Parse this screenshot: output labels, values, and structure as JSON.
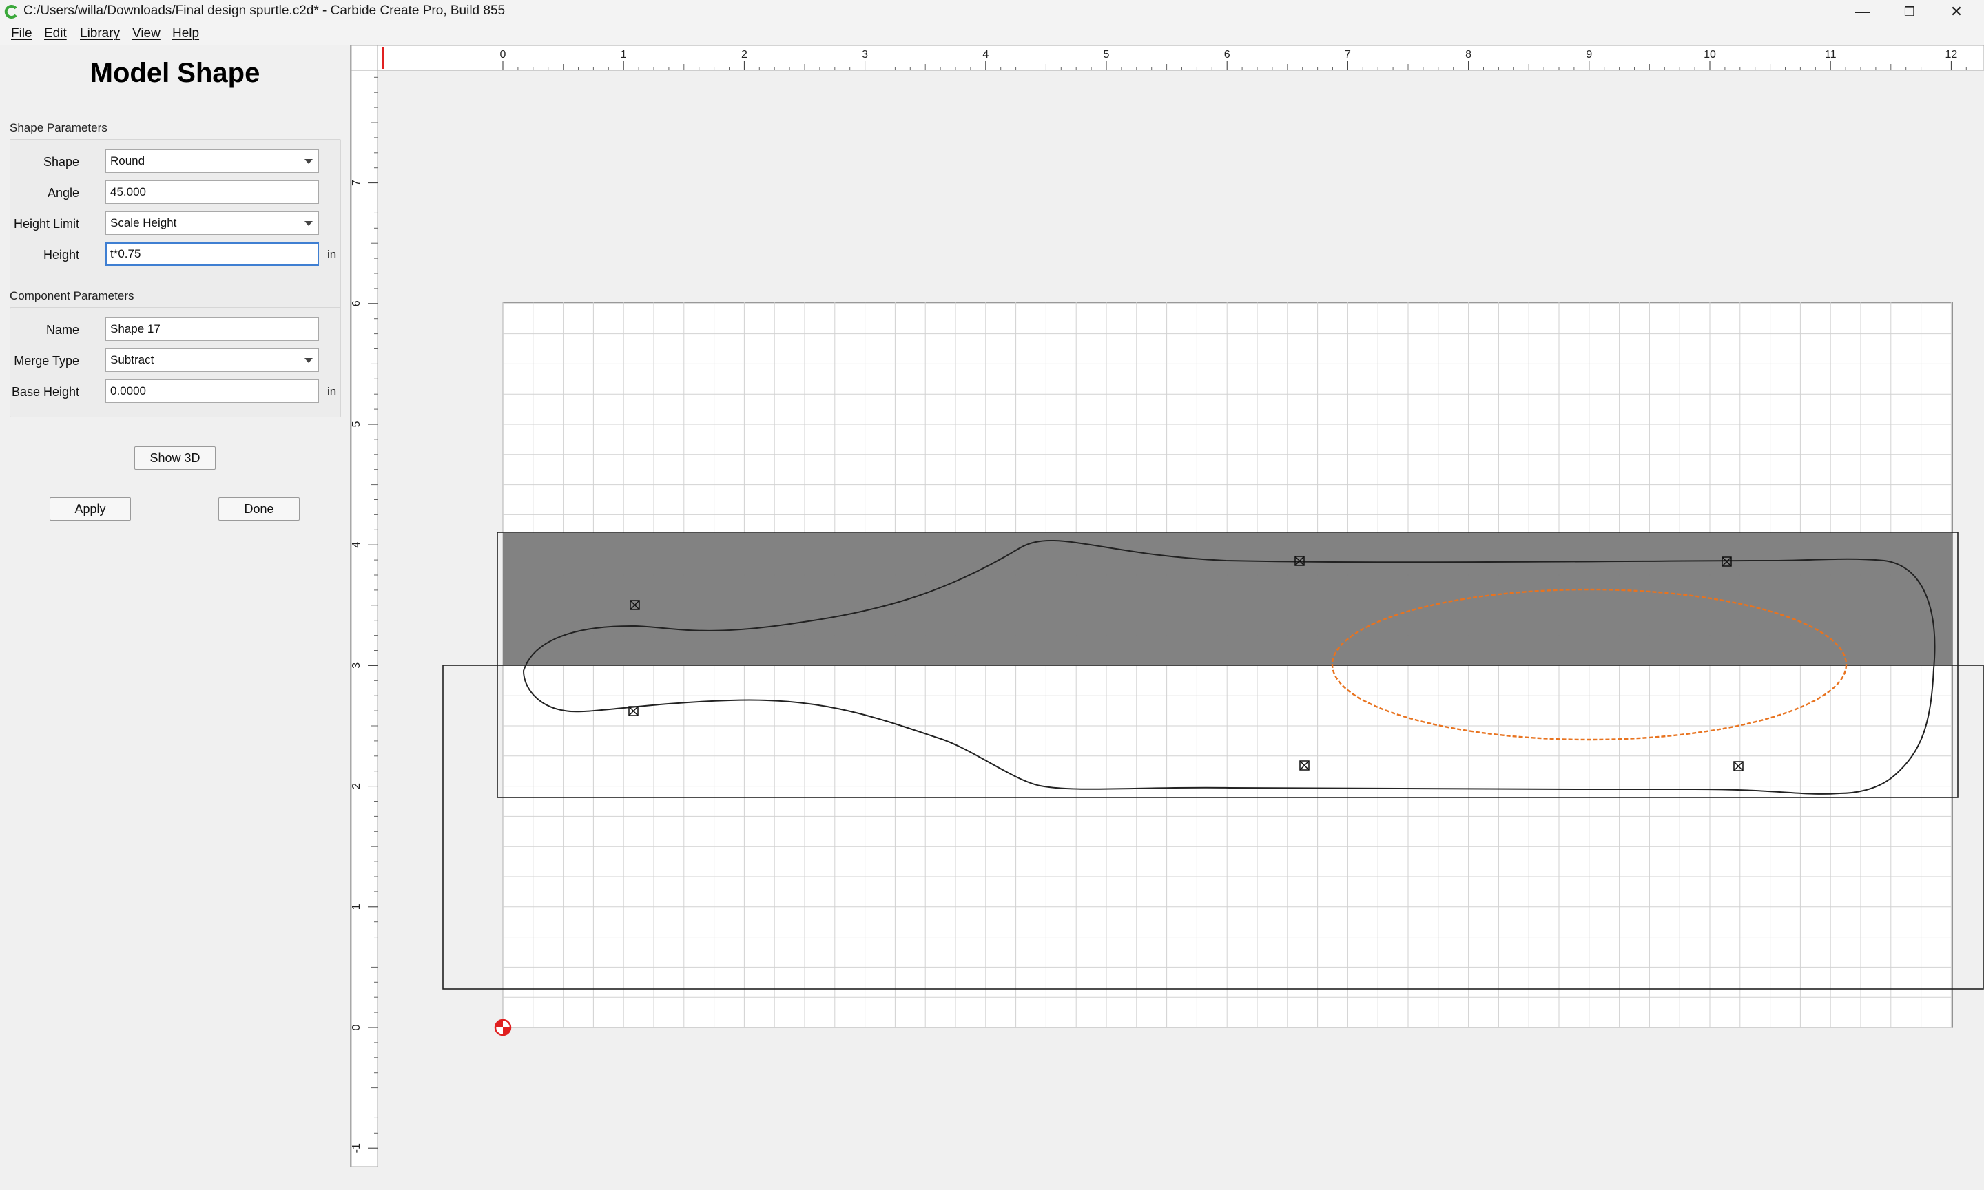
{
  "window": {
    "title": "C:/Users/willa/Downloads/Final design spurtle.c2d* - Carbide Create Pro, Build 855",
    "controls": {
      "minimize": "—",
      "restore": "❐",
      "close": "✕"
    }
  },
  "menu": {
    "items": [
      "File",
      "Edit",
      "Library",
      "View",
      "Help"
    ]
  },
  "panel": {
    "title": "Model Shape",
    "shape_params": {
      "label": "Shape Parameters",
      "shape_label": "Shape",
      "shape_value": "Round",
      "angle_label": "Angle",
      "angle_value": "45.000",
      "height_limit_label": "Height Limit",
      "height_limit_value": "Scale Height",
      "height_label": "Height",
      "height_value": "t*0.75",
      "height_unit": "in"
    },
    "component_params": {
      "label": "Component Parameters",
      "name_label": "Name",
      "name_value": "Shape 17",
      "merge_type_label": "Merge Type",
      "merge_type_value": "Subtract",
      "base_height_label": "Base Height",
      "base_height_value": "0.0000",
      "base_height_unit": "in"
    },
    "buttons": {
      "show3d": "Show 3D",
      "apply": "Apply",
      "done": "Done"
    }
  },
  "canvas": {
    "units": "in",
    "x_ruler_labels": [
      "0",
      "1",
      "2",
      "3",
      "4",
      "5",
      "6",
      "7",
      "8",
      "9",
      "10",
      "11",
      "12"
    ],
    "y_ruler_labels": [
      "7",
      "6",
      "5",
      "4",
      "3",
      "2",
      "1",
      "0",
      "-1"
    ],
    "colors": {
      "background": "#f0f0f0",
      "stock": "#ffffff",
      "grid": "#d2d2d2",
      "shaded_band": "#7f7f7f",
      "outline": "#222222",
      "selection": "#e8731f",
      "origin": "#e02020"
    }
  }
}
